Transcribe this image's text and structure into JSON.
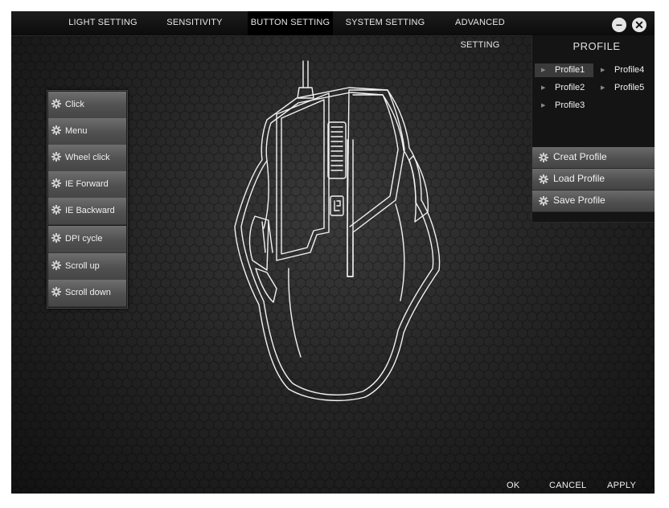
{
  "tabs": [
    {
      "label": "LIGHT SETTING"
    },
    {
      "label": "SENSITIVITY"
    },
    {
      "label": "BUTTON SETTING"
    },
    {
      "label": "SYSTEM SETTING"
    },
    {
      "label": "ADVANCED SETTING"
    }
  ],
  "window": {
    "minimize_icon": "minus-icon",
    "close_icon": "close-icon"
  },
  "button_functions": [
    {
      "label": "Click"
    },
    {
      "label": "Menu"
    },
    {
      "label": "Wheel click"
    },
    {
      "label": "IE Forward"
    },
    {
      "label": "IE Backward"
    },
    {
      "label": "DPI cycle"
    },
    {
      "label": "Scroll up"
    },
    {
      "label": "Scroll down"
    }
  ],
  "profile": {
    "title": "PROFILE",
    "profiles": [
      {
        "label": "Profile1",
        "selected": true
      },
      {
        "label": "Profile2",
        "selected": false
      },
      {
        "label": "Profile3",
        "selected": false
      },
      {
        "label": "Profile4",
        "selected": false
      },
      {
        "label": "Profile5",
        "selected": false
      }
    ],
    "actions": [
      {
        "label": "Creat Profile"
      },
      {
        "label": "Load Profile"
      },
      {
        "label": "Save Profile"
      }
    ]
  },
  "footer": {
    "ok": "OK",
    "cancel": "CANCEL",
    "apply": "APPLY"
  },
  "colors": {
    "background": "#262626",
    "tab_active": "#000000",
    "button_face": "#5a5a5a",
    "outline": "#ffffff"
  }
}
